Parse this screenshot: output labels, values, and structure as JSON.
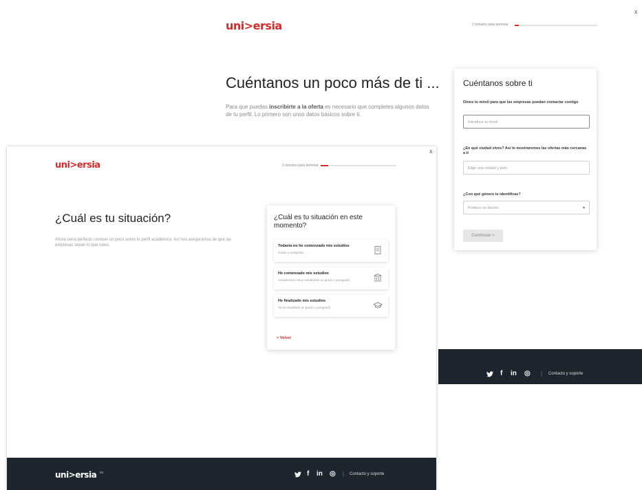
{
  "back": {
    "logo": "uni>ersia",
    "progress_label": "2 minutos para terminar",
    "progress_fraction": 0.05,
    "close": "x",
    "title": "Cuéntanos un poco más de ti ...",
    "desc_pre": "Para que puedas ",
    "desc_bold": "inscribirte a la oferta",
    "desc_post": " es necesario que completes algunos datos de tu perfil. Lo primero son unos datos básicos sobre ti.",
    "card": {
      "title": "Cuéntanos sobre ti",
      "phone_label": "Dinos tu móvil para que las empresas puedan contactar contigo",
      "phone_placeholder": "Introduce tu móvil",
      "city_label": "¿En qué ciudad vives? Así te mostraremos las ofertas más cercanas a ti",
      "city_placeholder": "Elige una ciudad y país",
      "gender_label": "¿Con qué género te identificas?",
      "gender_value": "Prefiero no decirlo",
      "continue": "Continuar >"
    },
    "footer": {
      "twitter": "🐦",
      "facebook": "f",
      "linkedin": "in",
      "instagram": "◎",
      "sep": "|",
      "contact": "Contacto y soporte"
    }
  },
  "front": {
    "logo": "uni>ersia",
    "progress_label": "2 minutos para terminar",
    "progress_fraction": 0.1,
    "close": "x",
    "title": "¿Cuál es tu situación?",
    "desc": "Ahora sería perfecto conocer un poco sobre tu perfil académico. Así nos aseguramos de que las empresas sepan lo que vales.",
    "card": {
      "title": "¿Cuál es tu situación en este momento?",
      "options": [
        {
          "title": "Todavía no he comenzado mis estudios",
          "sub": "Grado o postgrado",
          "icon": "document-icon"
        },
        {
          "title": "He comenzado mis estudios",
          "sub": "Actualmente estoy estudiando un grado o postgrado",
          "icon": "institution-icon"
        },
        {
          "title": "He finalizado mis estudios",
          "sub": "Ya he estudiado un grado o postgrado",
          "icon": "graduation-cap-icon"
        }
      ],
      "back": "< Volver"
    },
    "footer": {
      "logo": "uni>ersia",
      "logo_suffix": "es",
      "twitter": "🐦",
      "facebook": "f",
      "linkedin": "in",
      "instagram": "◎",
      "sep": "|",
      "contact": "Contacto y soporte"
    }
  },
  "colors": {
    "brand": "#d62b2b",
    "footer": "#1e252d"
  }
}
